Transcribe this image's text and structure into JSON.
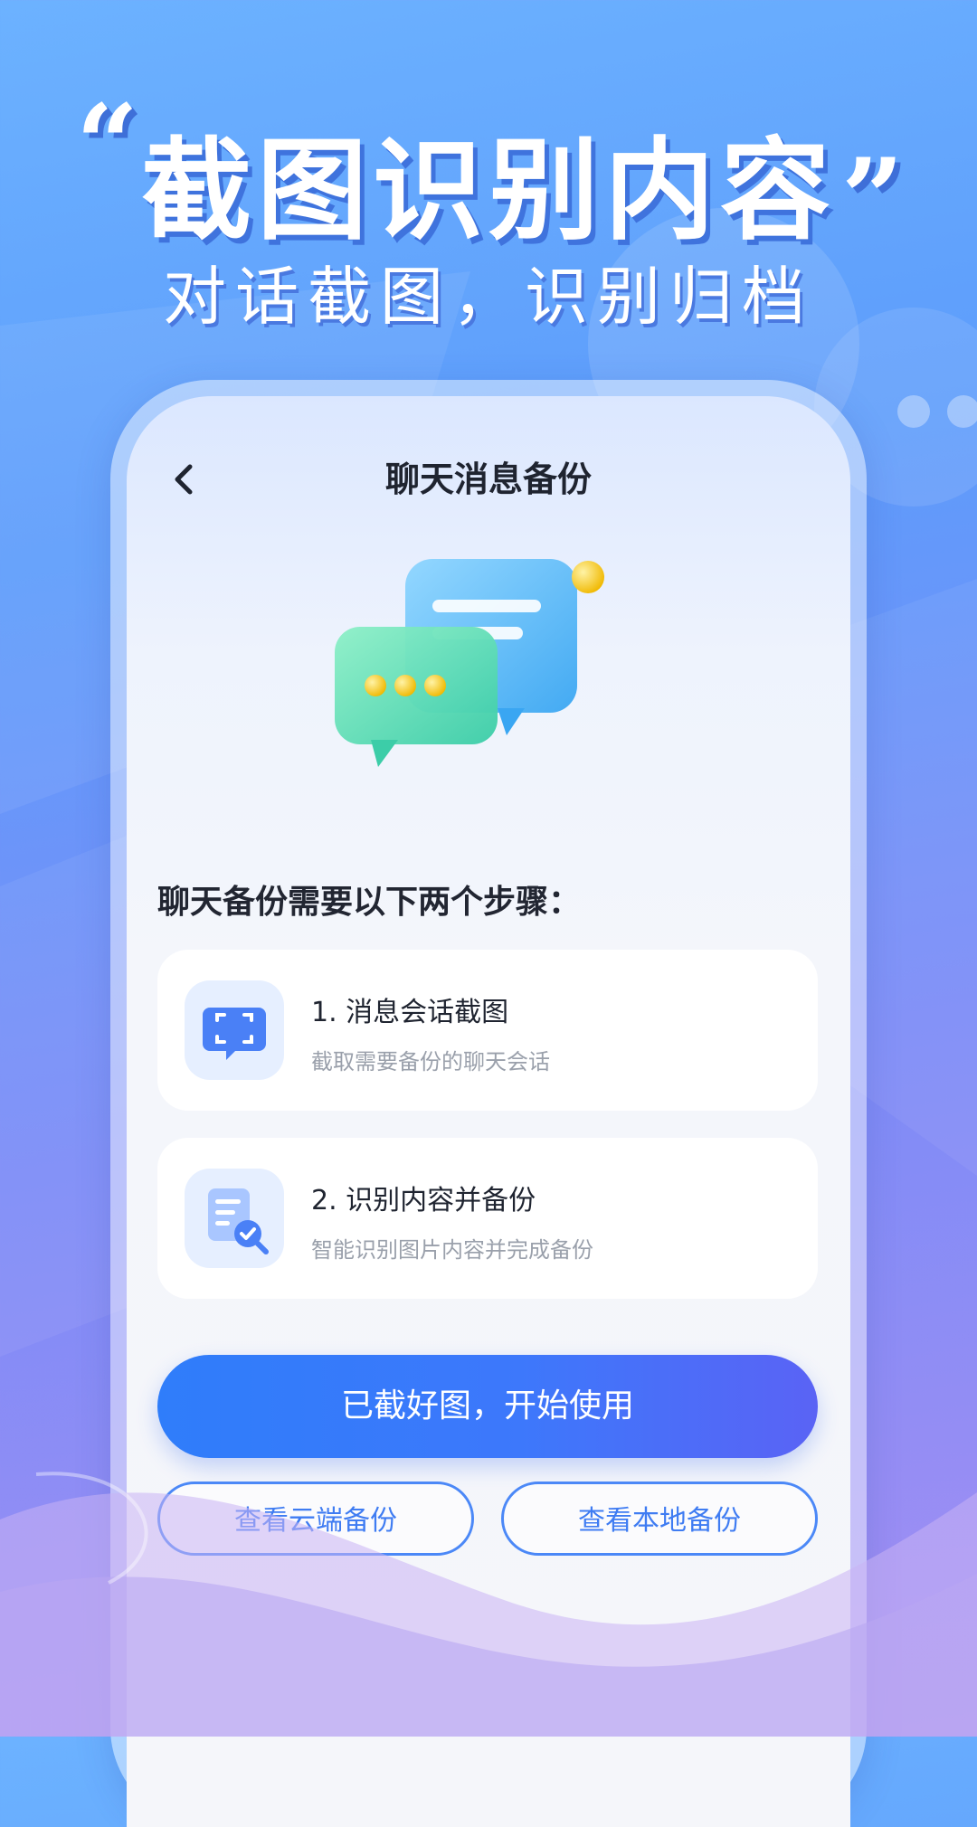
{
  "headline": {
    "open_quote": "“",
    "title": "截图识别内容",
    "close_quote": "”",
    "subtitle": "对话截图，识别归档"
  },
  "nav": {
    "back_icon": "chevron-left-icon",
    "title": "聊天消息备份"
  },
  "hero": {
    "icon": "chat-bubbles-illustration"
  },
  "steps_section": {
    "title": "聊天备份需要以下两个步骤：",
    "steps": [
      {
        "icon": "screenshot-icon",
        "title": "1. 消息会话截图",
        "desc": "截取需要备份的聊天会话"
      },
      {
        "icon": "document-scan-icon",
        "title": "2. 识别内容并备份",
        "desc": "智能识别图片内容并完成备份"
      }
    ]
  },
  "actions": {
    "primary": "已截好图，开始使用",
    "cloud": "查看云端备份",
    "local": "查看本地备份"
  },
  "colors": {
    "accent": "#3d78fb",
    "primary_gradient_end": "#5a63f5",
    "background_top": "#6cb2ff",
    "background_bottom": "#a58ef2"
  }
}
